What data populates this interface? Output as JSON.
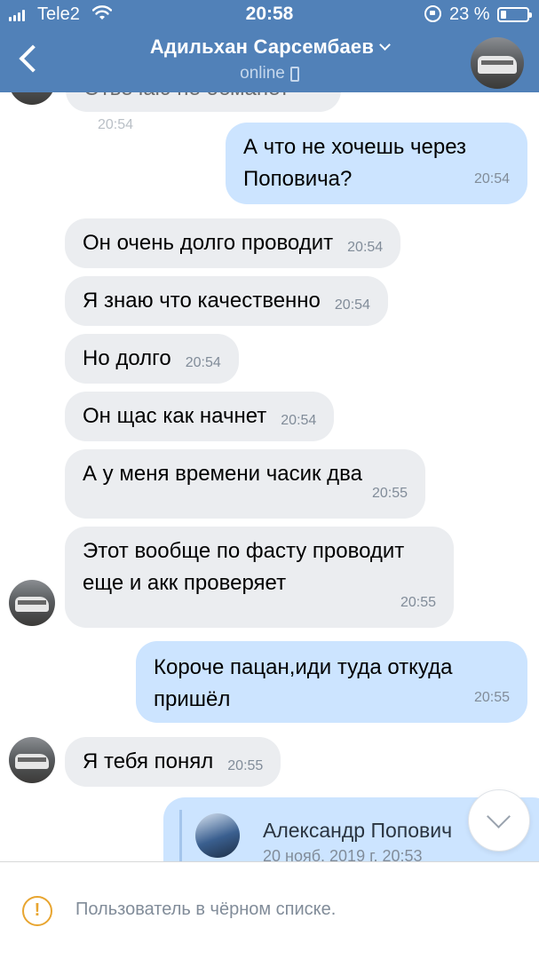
{
  "status_bar": {
    "carrier": "Tele2",
    "time": "20:58",
    "battery": "23 %"
  },
  "header": {
    "contact_name": "Адильхан Сарсембаев",
    "presence": "online"
  },
  "partial_message": {
    "text": "Отвечаю не обманет",
    "time": "20:54"
  },
  "messages": [
    {
      "dir": "out",
      "text": "А что не хочешь через Поповича?",
      "time": "20:54"
    },
    {
      "dir": "in",
      "text": "Он очень долго проводит",
      "time": "20:54"
    },
    {
      "dir": "in",
      "text": "Я знаю что качественно",
      "time": "20:54"
    },
    {
      "dir": "in",
      "text": "Но долго",
      "time": "20:54"
    },
    {
      "dir": "in",
      "text": "Он щас как начнет",
      "time": "20:54"
    },
    {
      "dir": "in",
      "text": "А у меня времени часик два",
      "time": "20:55"
    },
    {
      "dir": "in",
      "text": "Этот вообще по фасту проводит еще и акк проверяет",
      "time": "20:55"
    },
    {
      "dir": "out",
      "text": "Короче пацан,иди туда откуда пришёл",
      "time": "20:55"
    },
    {
      "dir": "in",
      "text": "Я тебя понял",
      "time": "20:55"
    }
  ],
  "forwarded": {
    "name": "Александр Попович",
    "date": "20 нояб. 2019 г. 20:53"
  },
  "footer": {
    "notice": "Пользователь в чёрном списке."
  },
  "colors": {
    "header": "#5181b8",
    "incoming": "#ebedf0",
    "outgoing": "#cce4ff",
    "warning": "#e8a530"
  },
  "icons": [
    "back-icon",
    "chevron-down-icon",
    "phone-icon",
    "wifi-icon",
    "lock-rotation-icon",
    "battery-icon",
    "warning-icon",
    "scroll-down-icon"
  ]
}
